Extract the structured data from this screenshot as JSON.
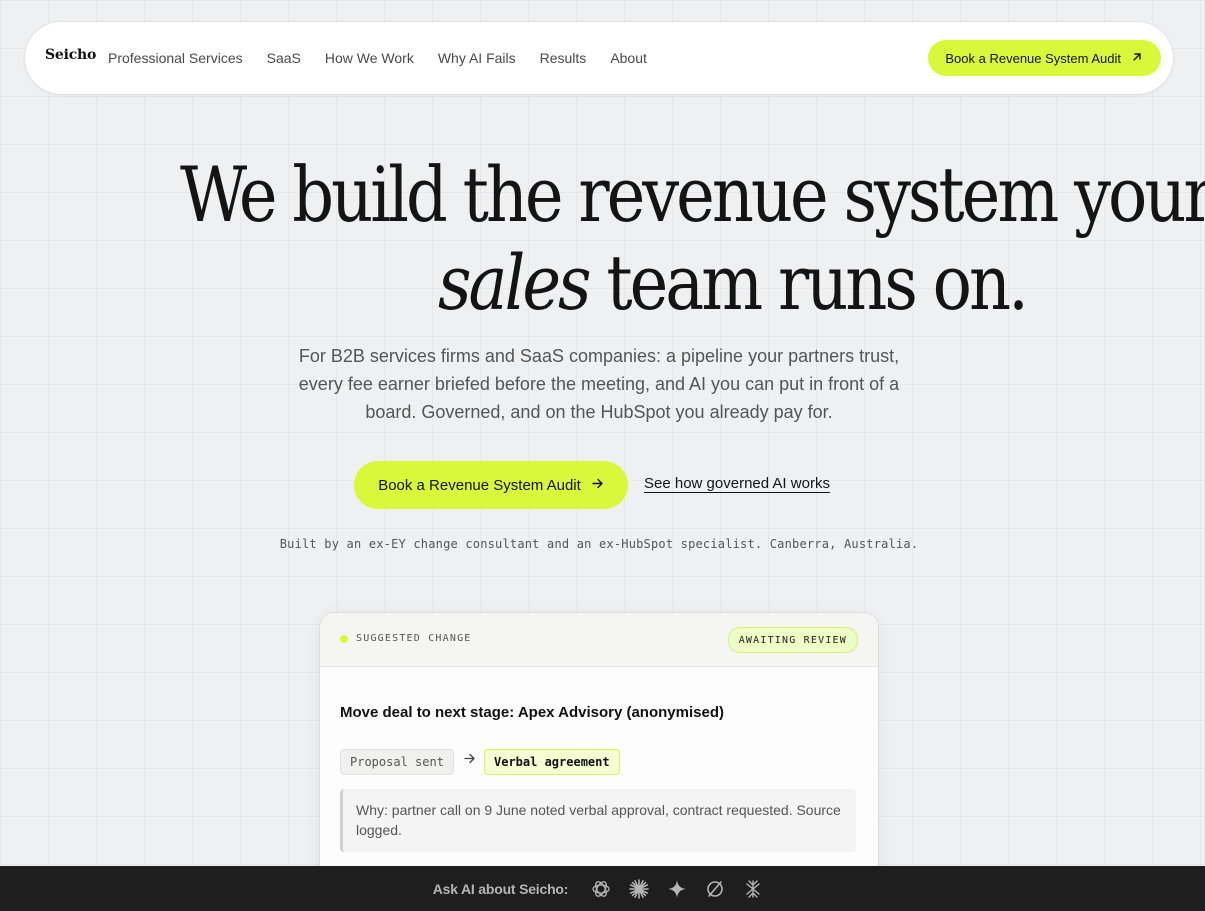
{
  "nav": {
    "logo": "Seicho",
    "links": [
      "Professional Services",
      "SaaS",
      "How We Work",
      "Why AI Fails",
      "Results",
      "About"
    ],
    "cta_label": "Book a Revenue System Audit",
    "cta_icon": "arrow-up-right-icon"
  },
  "hero": {
    "line1": "We build the revenue system your",
    "line2_em": "sales",
    "line2_rest": " team runs on.",
    "subtitle": "For B2B services firms and SaaS companies: a pipeline your partners trust, every fee earner briefed before the meeting, and AI you can put in front of a board. Governed, and on the HubSpot you already pay for.",
    "primary_cta": "Book a Revenue System Audit",
    "primary_cta_icon": "arrow-right-icon",
    "secondary_cta": "See how governed AI works",
    "credit": "Built by an ex-EY change consultant and an ex-HubSpot specialist. Canberra, Australia."
  },
  "card": {
    "label": "SUGGESTED CHANGE",
    "badge": "AWAITING REVIEW",
    "title": "Move deal to next stage: Apex Advisory (anonymised)",
    "from_stage": "Proposal sent",
    "to_stage": "Verbal agreement",
    "why": "Why: partner call on 9 June noted verbal approval, contract requested. Source logged."
  },
  "ask_bar": {
    "label": "Ask AI about Seicho:",
    "icons": [
      "openai-icon",
      "claude-icon",
      "gemini-icon",
      "perplexity-icon",
      "grok-icon"
    ]
  },
  "colors": {
    "accent": "#d9f839",
    "background": "#eef0f1",
    "dark_bar": "#1e1e1e"
  }
}
